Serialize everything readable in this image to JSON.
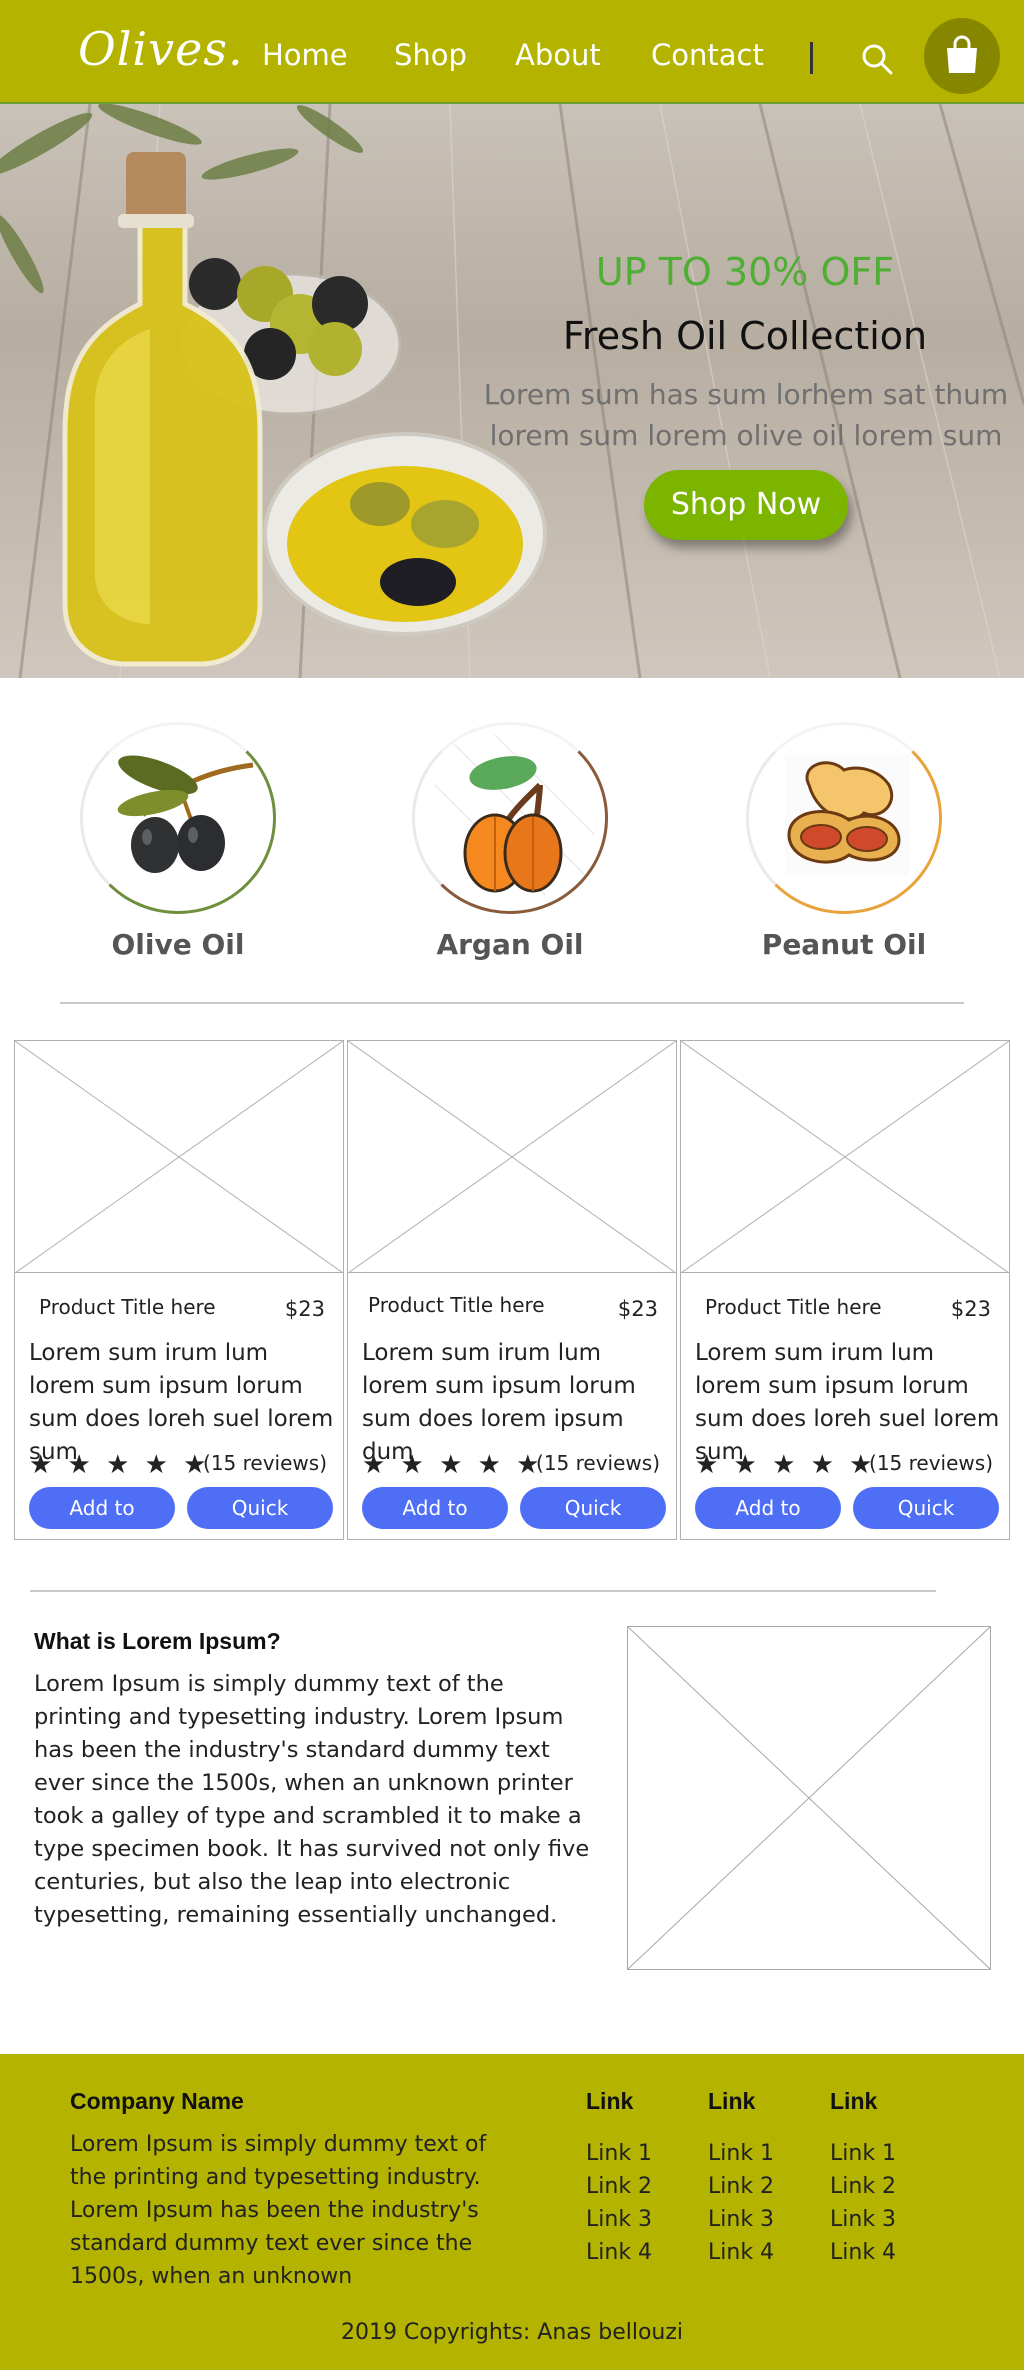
{
  "header": {
    "logo": "Olives.",
    "nav": [
      "Home",
      "Shop",
      "About",
      "Contact"
    ],
    "search_icon": "search-icon",
    "cart_icon": "shopping-bag-icon"
  },
  "hero": {
    "promo": "UP TO 30% OFF",
    "title": "Fresh Oil Collection",
    "text": "Lorem sum has sum lorhem sat thum lorem sum lorem olive oil lorem sum",
    "button": "Shop Now"
  },
  "categories": [
    {
      "label": "Olive Oil",
      "icon": "olive-branch-icon",
      "ring": "#6f8f3e"
    },
    {
      "label": "Argan Oil",
      "icon": "argan-fruit-icon",
      "ring": "#8a5a3c"
    },
    {
      "label": "Peanut Oil",
      "icon": "peanut-icon",
      "ring": "#e8a43a"
    }
  ],
  "products": [
    {
      "title": "Product Title here",
      "price": "$23",
      "description": "Lorem sum irum lum lorem sum ipsum lorum sum does loreh suel lorem sum",
      "rating": "★ ★ ★ ★ ★",
      "reviews": "(15 reviews)",
      "add_label": "Add to",
      "quick_label": "Quick"
    },
    {
      "title": "Product Title here",
      "price": "$23",
      "description": "Lorem sum irum lum lorem sum ipsum lorum sum does lorem ipsum dum",
      "rating": "★ ★ ★ ★ ★",
      "reviews": "(15 reviews)",
      "add_label": "Add to",
      "quick_label": "Quick"
    },
    {
      "title": "Product Title here",
      "price": "$23",
      "description": "Lorem sum irum lum lorem sum ipsum lorum sum does loreh suel lorem sum",
      "rating": "★ ★ ★ ★ ★",
      "reviews": "(15 reviews)",
      "add_label": "Add to",
      "quick_label": "Quick"
    }
  ],
  "about": {
    "heading": "What is Lorem Ipsum?",
    "text": "Lorem Ipsum is simply dummy text of the printing and typesetting industry. Lorem Ipsum has been the industry's standard dummy text ever since the 1500s, when an unknown printer took a galley of type and scrambled it to make a type specimen book. It has survived not only five centuries, but also the leap into electronic typesetting, remaining essentially unchanged."
  },
  "footer": {
    "company": "Company Name",
    "description": "Lorem Ipsum is simply dummy text of the printing and typesetting industry. Lorem Ipsum has been the industry's standard dummy text ever since the 1500s, when an unknown",
    "columns": [
      {
        "heading": "Link",
        "links": [
          "Link 1",
          "Link 2",
          "Link 3",
          "Link 4"
        ]
      },
      {
        "heading": "Link",
        "links": [
          "Link 1",
          "Link 2",
          "Link 3",
          "Link 4"
        ]
      },
      {
        "heading": "Link",
        "links": [
          "Link 1",
          "Link 2",
          "Link 3",
          "Link 4"
        ]
      }
    ],
    "copyright": "2019 Copyrights: Anas bellouzi"
  },
  "colors": {
    "header_bg": "#b3b300",
    "promo": "#4fae34",
    "shop_button": "#7cb500",
    "product_button": "#4e6ef5",
    "footer_bg": "#b3b300"
  }
}
